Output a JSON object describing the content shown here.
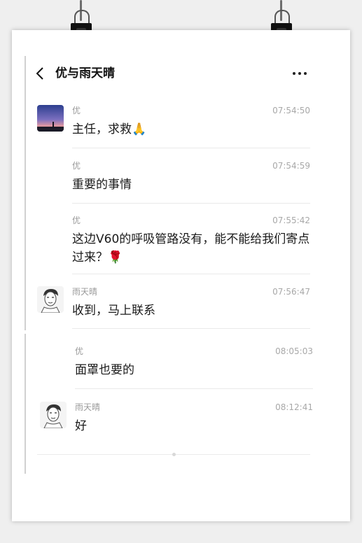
{
  "chat": {
    "title": "优与雨天晴"
  },
  "messages": [
    {
      "sender": "优",
      "time": "07:54:50",
      "text": "主任，求救🙏"
    },
    {
      "sender": "",
      "time": "07:54:59",
      "text": "重要的事情",
      "name_on_line": "优"
    },
    {
      "sender": "优",
      "time": "07:55:42",
      "text": "这边V60的呼吸管路没有，能不能给我们寄点过来？🌹"
    },
    {
      "sender": "雨天晴",
      "time": "07:56:47",
      "text": "收到，马上联系"
    },
    {
      "sender": "优",
      "time": "08:05:03",
      "text": "面罩也要的"
    },
    {
      "sender": "雨天晴",
      "time": "08:12:41",
      "text": "好"
    }
  ],
  "icons": {
    "back": "chevron-left-icon",
    "more": "more-dots-icon"
  },
  "colors": {
    "background": "#efefef",
    "paper": "#ffffff",
    "text": "#1a1a1a",
    "meta": "#9a9a9a"
  }
}
